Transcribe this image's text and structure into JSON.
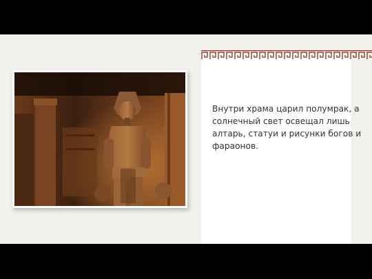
{
  "slide": {
    "body_text": "Внутри  храма царил полумрак, а солнечный свет освещал лишь алтарь, статуи и рисунки богов и фараонов."
  },
  "photo": {
    "icon": "pharaoh-statue-photo"
  },
  "colors": {
    "background": "#000000",
    "slide": "#f3f1ee",
    "panel": "#ffffff",
    "ornament": "#8a2a10",
    "text": "#333333"
  }
}
